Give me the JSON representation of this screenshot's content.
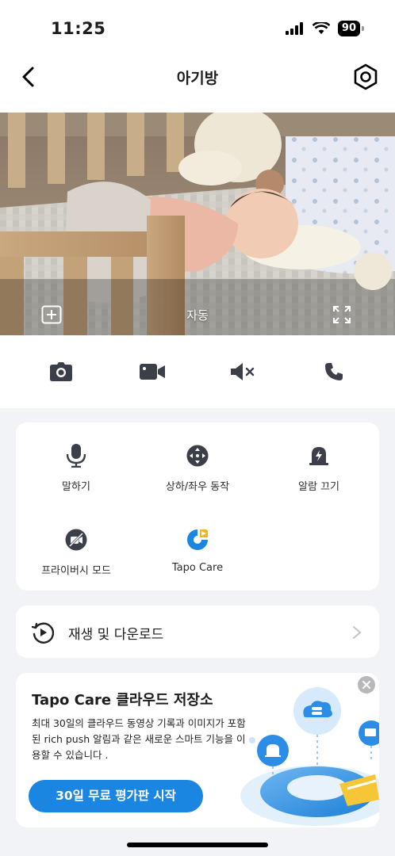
{
  "status_bar": {
    "time": "11:25",
    "battery": "90"
  },
  "nav": {
    "title": "아기방"
  },
  "camera": {
    "mode_label": "자동"
  },
  "controls": [
    "camera-icon",
    "video-record-icon",
    "speaker-muted-icon",
    "phone-icon"
  ],
  "actions": [
    {
      "label": "말하기",
      "icon": "microphone-icon"
    },
    {
      "label": "상하/좌우 동작",
      "icon": "pan-tilt-icon"
    },
    {
      "label": "알람 끄기",
      "icon": "alarm-icon"
    },
    {
      "label": "프라이버시 모드",
      "icon": "privacy-mode-icon"
    },
    {
      "label": "Tapo Care",
      "icon": "tapo-care-icon"
    }
  ],
  "playback": {
    "label": "재생 및 다운로드"
  },
  "promo": {
    "title": "Tapo Care 클라우드 저장소",
    "description": "최대 30일의 클라우드 동영상 기록과 이미지가 포함된 rich push 알림과 같은 새로운 스마트 기능을 이용할 수 있습니다 .",
    "button": "30일 무료 평가판 시작"
  },
  "colors": {
    "accent": "#1b86e1",
    "icon": "#3a3f4a"
  }
}
